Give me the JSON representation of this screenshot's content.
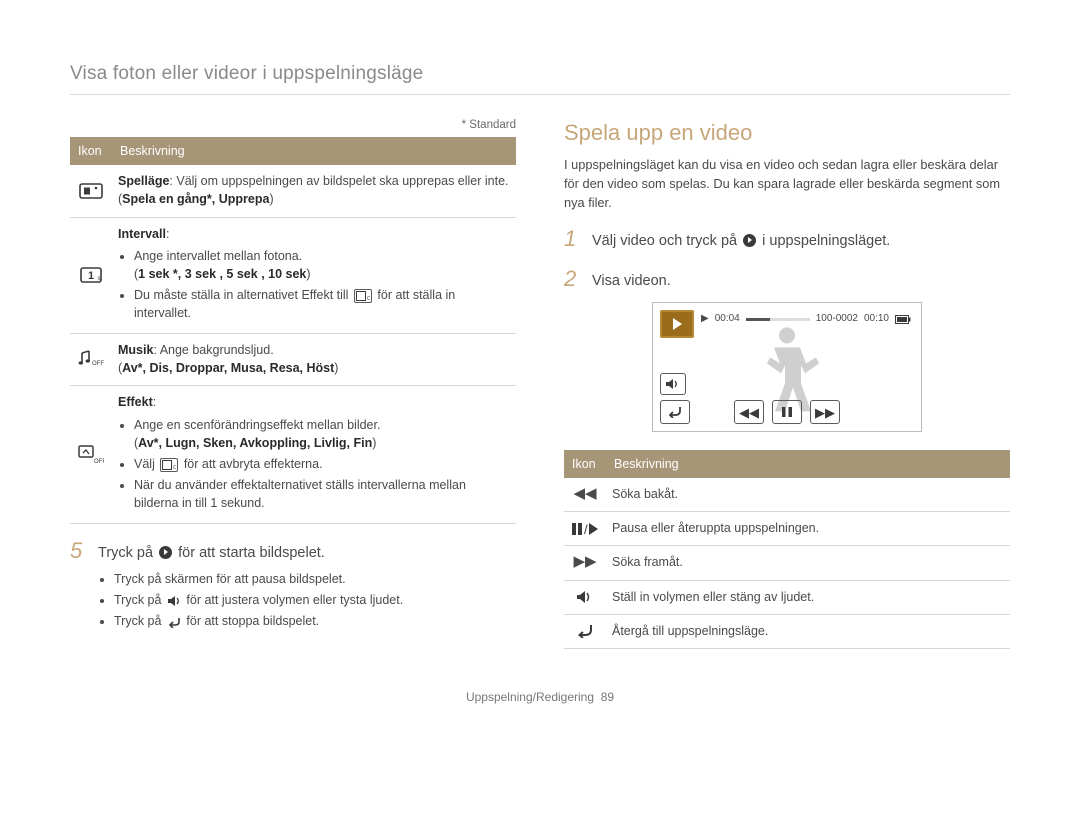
{
  "header": "Visa foton eller videor i uppspelningsläge",
  "left": {
    "standard_note": "* Standard",
    "table_headers": {
      "icon": "Ikon",
      "desc": "Beskrivning"
    },
    "rows": [
      {
        "type": "playmode",
        "label": "Spelläge",
        "text": ": Välj om uppspelningen av bildspelet ska upprepas eller inte. (",
        "opts": "Spela en gång*, Upprepa",
        "text2": ")"
      },
      {
        "type": "interval",
        "label": "Intervall",
        "b1": "Ange intervallet mellan fotona.",
        "opts": "1 sek *, 3 sek , 5 sek , 10 sek",
        "b2a": "Du måste ställa in alternativet Effekt till ",
        "b2b": " för att ställa in intervallet."
      },
      {
        "type": "music",
        "label": "Musik",
        "text": ": Ange bakgrundsljud.",
        "opts": "Av*, Dis, Droppar, Musa, Resa, Höst"
      },
      {
        "type": "effect",
        "label": "Effekt",
        "b1": "Ange en scenförändringseffekt mellan bilder.",
        "opts": "Av*, Lugn, Sken, Avkoppling, Livlig, Fin",
        "b2a": "Välj ",
        "b2b": " för att avbryta effekterna.",
        "b3": "När du använder effektalternativet ställs intervallerna mellan bilderna in till 1 sekund."
      }
    ],
    "step5": {
      "num": "5",
      "text_a": "Tryck på ",
      "text_b": " för att starta bildspelet."
    },
    "bullets": [
      {
        "a": "Tryck på skärmen för att pausa bildspelet.",
        "icon": null
      },
      {
        "a": "Tryck på ",
        "b": " för att justera volymen eller tysta ljudet.",
        "icon": "speaker"
      },
      {
        "a": "Tryck på ",
        "b": " för att stoppa bildspelet.",
        "icon": "return"
      }
    ]
  },
  "right": {
    "heading": "Spela upp en video",
    "intro": "I uppspelningsläget kan du visa en video och sedan lagra eller beskära delar för den video som spelas. Du kan spara lagrade eller beskärda segment som nya filer.",
    "step1": {
      "num": "1",
      "a": "Välj video och tryck på ",
      "b": " i uppspelningsläget."
    },
    "step2": {
      "num": "2",
      "text": "Visa videon."
    },
    "vp": {
      "elapsed": "00:04",
      "total": "00:10",
      "file": "100-0002"
    },
    "table_headers": {
      "icon": "Ikon",
      "desc": "Beskrivning"
    },
    "rows": [
      {
        "icon": "rewind",
        "text": "Söka bakåt."
      },
      {
        "icon": "pauseplay",
        "text": "Pausa eller återuppta uppspelningen."
      },
      {
        "icon": "forward",
        "text": "Söka framåt."
      },
      {
        "icon": "speaker",
        "text": "Ställ in volymen eller stäng av ljudet."
      },
      {
        "icon": "return",
        "text": "Återgå till uppspelningsläge."
      }
    ]
  },
  "footer": {
    "label": "Uppspelning/Redigering",
    "page": "89"
  }
}
